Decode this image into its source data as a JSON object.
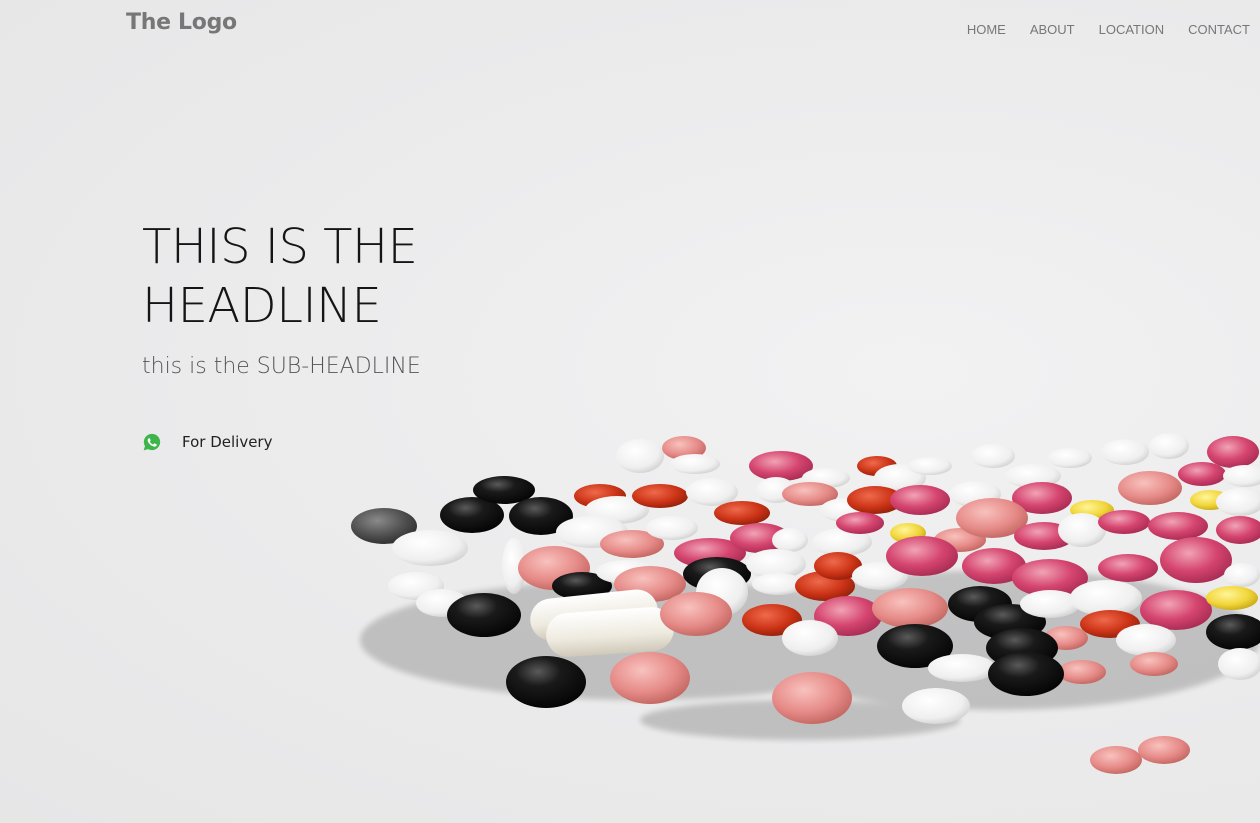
{
  "header": {
    "logo_text": "The Logo",
    "nav": [
      {
        "label": "HOME"
      },
      {
        "label": "ABOUT"
      },
      {
        "label": "LOCATION"
      },
      {
        "label": "CONTACT"
      }
    ]
  },
  "hero": {
    "headline_line1": "THIS IS THE",
    "headline_line2": "HEADLINE",
    "subheadline": "this is the SUB-HEADLINE",
    "delivery_label": "For Delivery",
    "delivery_icon": "whatsapp-icon",
    "image_subject": "scattered-pills-photo"
  },
  "colors": {
    "background": "#e8e8e9",
    "logo": "#777777",
    "nav": "#777777",
    "headline": "#151515",
    "subheadline": "#555555",
    "whatsapp": "#3db54a"
  }
}
